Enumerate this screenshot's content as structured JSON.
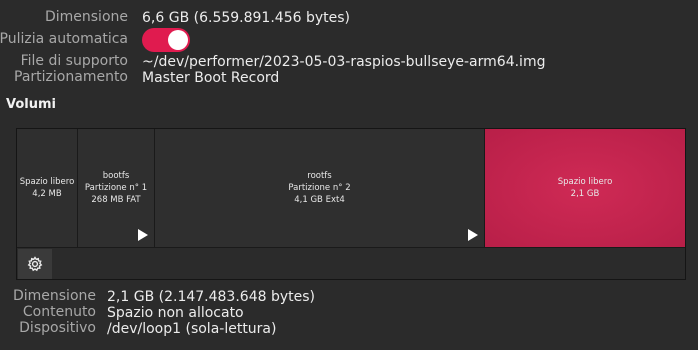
{
  "disk_info": {
    "size": {
      "label": "Dimensione",
      "value": "6,6 GB (6.559.891.456 bytes)"
    },
    "auto_clear": {
      "label": "Pulizia automatica",
      "enabled": true
    },
    "backing_file": {
      "label": "File di supporto",
      "value": "~/dev/performer/2023-05-03-raspios-bullseye-arm64.img"
    },
    "partitioning": {
      "label": "Partizionamento",
      "value": "Master Boot Record"
    }
  },
  "volumes": {
    "title": "Volumi",
    "partitions": [
      {
        "name": "Spazio libero",
        "subtitle": "",
        "detail": "4,2 MB",
        "selected": false
      },
      {
        "name": "bootfs",
        "subtitle": "Partizione n° 1",
        "detail": "268 MB FAT",
        "selected": false
      },
      {
        "name": "rootfs",
        "subtitle": "Partizione n° 2",
        "detail": "4,1 GB Ext4",
        "selected": false
      },
      {
        "name": "Spazio libero",
        "subtitle": "",
        "detail": "2,1 GB",
        "selected": true
      }
    ],
    "toolbar_icon": "gear-icon"
  },
  "selected_volume": {
    "size": {
      "label": "Dimensione",
      "value": "2,1 GB (2.147.483.648 bytes)"
    },
    "content": {
      "label": "Contenuto",
      "value": "Spazio non allocato"
    },
    "device": {
      "label": "Dispositivo",
      "value": "/dev/loop1 (sola-lettura)"
    }
  },
  "colors": {
    "accent": "#e01b4f",
    "selected_partition": "#c3234f",
    "background": "#2b2b2b"
  }
}
